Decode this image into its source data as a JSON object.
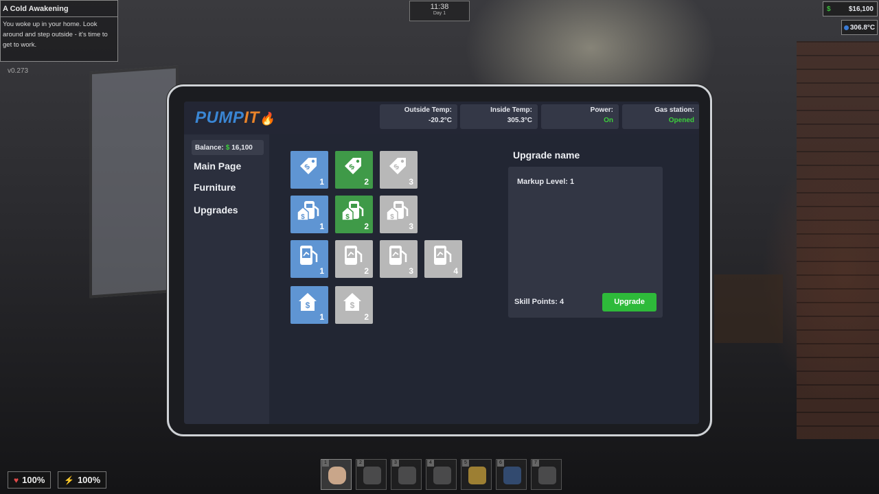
{
  "hud": {
    "quest_title": "A Cold Awakening",
    "quest_desc": "You woke up in your home. Look around and step outside - it's time to get to work.",
    "version": "v0.273",
    "clock_time": "11:38",
    "clock_day": "Day 1",
    "money_symbol": "$",
    "money": "$16,100",
    "outside_temp": "306.8°C",
    "health": "100%",
    "energy": "100%",
    "hotbar": [
      {
        "num": "1",
        "item": "fist-icon",
        "active": true
      },
      {
        "num": "2",
        "item": "drill-icon"
      },
      {
        "num": "3",
        "item": "axe-icon"
      },
      {
        "num": "4",
        "item": "shovel-icon"
      },
      {
        "num": "5",
        "item": "broom-icon"
      },
      {
        "num": "6",
        "item": "fuel-nozzle-icon"
      },
      {
        "num": "7",
        "item": "shotgun-icon"
      }
    ]
  },
  "tablet": {
    "logo_part1": "PUMP",
    "logo_part2": "IT",
    "stats": {
      "outside_label": "Outside Temp:",
      "outside_value": "-20.2°C",
      "inside_label": "Inside Temp:",
      "inside_value": "305.3°C",
      "power_label": "Power:",
      "power_value": "On",
      "station_label": "Gas station:",
      "station_value": "Opened"
    },
    "balance_label": "Balance:",
    "balance_symbol": "$",
    "balance_value": "16,100",
    "nav": [
      "Main Page",
      "Furniture",
      "Upgrades"
    ],
    "upgrade_rows": [
      {
        "icon": "price-tag-icon",
        "tiles": [
          {
            "level": "1",
            "state": "owned"
          },
          {
            "level": "2",
            "state": "selected"
          },
          {
            "level": "3",
            "state": "locked"
          }
        ]
      },
      {
        "icon": "pump-markup-icon",
        "tiles": [
          {
            "level": "1",
            "state": "owned"
          },
          {
            "level": "2",
            "state": "selected"
          },
          {
            "level": "3",
            "state": "locked"
          }
        ]
      },
      {
        "icon": "pump-speed-icon",
        "tiles": [
          {
            "level": "1",
            "state": "owned"
          },
          {
            "level": "2",
            "state": "locked"
          },
          {
            "level": "3",
            "state": "locked"
          },
          {
            "level": "4",
            "state": "locked"
          }
        ]
      },
      {
        "icon": "house-price-icon",
        "tiles": [
          {
            "level": "1",
            "state": "owned"
          },
          {
            "level": "2",
            "state": "locked"
          }
        ]
      }
    ],
    "panel": {
      "title": "Upgrade name",
      "level_text": "Markup Level: 1",
      "skill_points": "Skill Points: 4",
      "button": "Upgrade"
    },
    "colors": {
      "owned": "#5f95d3",
      "selected": "#3f9a48",
      "locked": "#b8b8b8",
      "button": "#2eba3a"
    }
  }
}
